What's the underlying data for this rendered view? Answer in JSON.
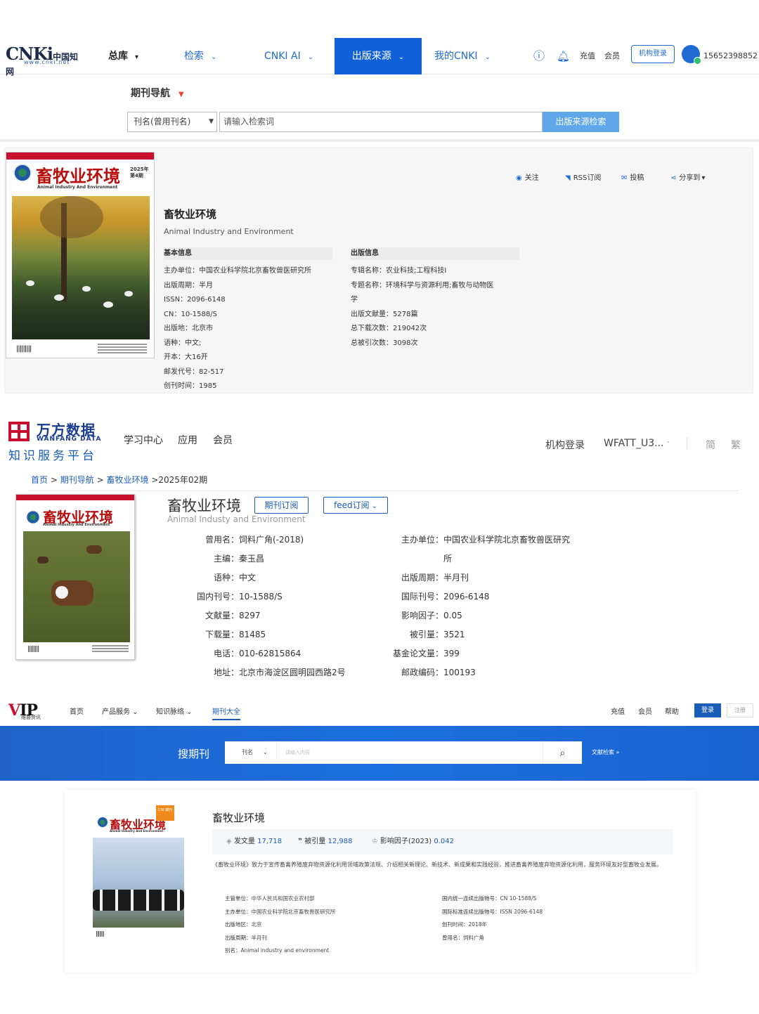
{
  "cnki": {
    "logo": {
      "big": "CNKi",
      "cn": "中国知网",
      "url": "www.cnki.net"
    },
    "nav": {
      "total": "总库",
      "search": "检索",
      "ai": "CNKI AI",
      "source": "出版来源",
      "mycnki": "我的CNKI"
    },
    "right": {
      "recharge": "充值",
      "member": "会员",
      "inst_login": "机构登录",
      "user": "15652398852"
    },
    "journal_nav": "期刊导航",
    "search": {
      "select": "刊名(曾用刊名)",
      "placeholder": "请输入检索词",
      "button": "出版来源检索"
    },
    "actions": {
      "follow": "关注",
      "rss": "RSS订阅",
      "submit": "投稿",
      "share": "分享到"
    },
    "cover": {
      "title": "畜牧业环境",
      "en": "Animal Industry And Environment",
      "issue": "2025年 第4期"
    },
    "journal": {
      "title": "畜牧业环境",
      "en_title": "Animal Industry and Environment"
    },
    "basic_head": "基本信息",
    "pub_head": "出版信息",
    "basic": [
      {
        "k": "主办单位：",
        "v": "中国农业科学院北京畜牧兽医研究所"
      },
      {
        "k": "出版周期：",
        "v": "半月"
      },
      {
        "k": "ISSN：",
        "v": "2096-6148"
      },
      {
        "k": "CN：",
        "v": "10-1588/S"
      },
      {
        "k": "出版地：",
        "v": "北京市"
      },
      {
        "k": "语种：",
        "v": "中文;"
      },
      {
        "k": "开本：",
        "v": "大16开"
      },
      {
        "k": "邮发代号：",
        "v": "82-517"
      },
      {
        "k": "创刊时间：",
        "v": "1985"
      }
    ],
    "pub": [
      {
        "k": "专辑名称：",
        "v": "农业科技;工程科技I"
      },
      {
        "k": "专题名称：",
        "v": "环境科学与资源利用;畜牧与动物医"
      },
      {
        "k": "",
        "v": "学"
      },
      {
        "k": "出版文献量：",
        "v": "5278篇"
      },
      {
        "k": "总下载次数：",
        "v": "219042次"
      },
      {
        "k": "总被引次数：",
        "v": "3098次"
      }
    ]
  },
  "wanfang": {
    "brand": "万方数据",
    "brand_en": "WANFANG DATA",
    "slogan": "知识服务平台",
    "nav": {
      "study": "学习中心",
      "apps": "应用",
      "member": "会员"
    },
    "right": {
      "inst": "机构登录",
      "user": "WFATT_U3...",
      "simp": "简",
      "trad": "繁"
    },
    "breadcrumb": {
      "home": "首页",
      "nav": "期刊导航",
      "journal": "畜牧业环境",
      "issue": ">2025年02期",
      "sep": ">"
    },
    "title": "畜牧业环境",
    "subtitle": "Animal Industy and Environment",
    "btn_sub": "期刊订阅",
    "btn_feed": "feed订阅",
    "left": [
      {
        "k": "曾用名：",
        "v": "饲料广角(-2018)"
      },
      {
        "k": "主编：",
        "v": "秦玉昌"
      },
      {
        "k": "语种：",
        "v": "中文"
      },
      {
        "k": "国内刊号：",
        "v": "10-1588/S"
      },
      {
        "k": "文献量：",
        "v": "8297"
      },
      {
        "k": "下载量：",
        "v": "81485"
      },
      {
        "k": "电话：",
        "v": "010-62815864"
      },
      {
        "k": "地址：",
        "v": "北京市海淀区圆明园西路2号"
      }
    ],
    "right_col": [
      {
        "k": "主办单位：",
        "v": "中国农业科学院北京畜牧兽医研究"
      },
      {
        "k": "",
        "v": "所"
      },
      {
        "k": "出版周期：",
        "v": "半月刊"
      },
      {
        "k": "国际刊号：",
        "v": "2096-6148"
      },
      {
        "k": "影响因子：",
        "v": "0.05"
      },
      {
        "k": "被引量：",
        "v": "3521"
      },
      {
        "k": "基金论文量：",
        "v": "399"
      },
      {
        "k": "邮政编码：",
        "v": "100193"
      }
    ]
  },
  "vip": {
    "logo": "VIP",
    "logo_sub": "维普资讯",
    "nav": {
      "home": "首页",
      "products": "产品服务",
      "knowledge": "知识脉络",
      "journals": "期刊大全"
    },
    "right": {
      "recharge": "充值",
      "member": "会员",
      "help": "帮助",
      "login": "登录",
      "register": "注册"
    },
    "banner_label": "搜期刊",
    "search": {
      "select": "刊名",
      "placeholder": "请输入内容",
      "adv": "文献检索 »"
    },
    "cover_badge": "CNI 期刊",
    "title": "畜牧业环境",
    "stats": {
      "papers_k": "发文量",
      "papers_v": "17,718",
      "cites_k": "被引量",
      "cites_v": "12,988",
      "if_k": "影响因子(2023)",
      "if_v": "0.042"
    },
    "desc": "《畜牧业环境》致力于宣传畜禽养殖废弃物资源化利用领域政策法规、介绍相关新理论、新技术、新成果和实践经验，推进畜禽养殖废弃物资源化利用，服务环境友好型畜牧业发展。",
    "left": [
      {
        "k": "主管单位：",
        "v": "中华人民共和国农业农村部"
      },
      {
        "k": "主办单位：",
        "v": "中国农业科学院北京畜牧兽医研究所"
      },
      {
        "k": "出版地区：",
        "v": "北京"
      },
      {
        "k": "",
        "v": ""
      },
      {
        "k": "出版周期：",
        "v": "半月刊"
      },
      {
        "k": "别名：",
        "v": "Animal industry and environment"
      }
    ],
    "right_col": [
      {
        "k": "国内统一连续出版物号：",
        "v": "CN 10-1588/S"
      },
      {
        "k": "国际标准连续出版物号：",
        "v": "ISSN 2096-6148"
      },
      {
        "k": "创刊时间：",
        "v": "2018年"
      },
      {
        "k": "曾用名：",
        "v": "饲料广角"
      }
    ]
  },
  "colors": {
    "cnki_blue": "#1260d8",
    "wanfang_blue": "#1a5db8",
    "vip_banner": "#1c6fe0",
    "cover_red": "#b80d0d"
  }
}
